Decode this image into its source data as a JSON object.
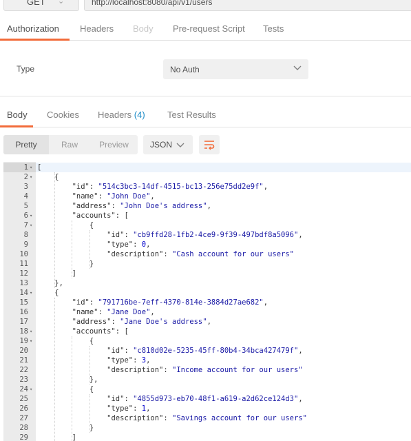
{
  "request": {
    "method": "GET",
    "url": "http://localhost:8080/api/v1/users"
  },
  "request_tabs": [
    "Authorization",
    "Headers",
    "Body",
    "Pre-request Script",
    "Tests"
  ],
  "auth": {
    "type_label": "Type",
    "selected": "No Auth"
  },
  "response_tabs": {
    "body": "Body",
    "cookies": "Cookies",
    "headers": "Headers",
    "headers_count": "(4)",
    "test_results": "Test Results"
  },
  "view_modes": [
    "Pretty",
    "Raw",
    "Preview"
  ],
  "format": "JSON",
  "colors": {
    "accent": "#f26b3a",
    "count": "#1a8ac7",
    "string": "#1a1aa6",
    "number": "#0000cd"
  },
  "code_lines": [
    {
      "n": "1",
      "fold": "▾",
      "t": "["
    },
    {
      "n": "2",
      "fold": "▾",
      "t": "    {"
    },
    {
      "n": "3",
      "fold": "",
      "t": "        \"id\": \"514c3bc3-14df-4515-bc13-256e75dd2e9f\","
    },
    {
      "n": "4",
      "fold": "",
      "t": "        \"name\": \"John Doe\","
    },
    {
      "n": "5",
      "fold": "",
      "t": "        \"address\": \"John Doe's address\","
    },
    {
      "n": "6",
      "fold": "▾",
      "t": "        \"accounts\": ["
    },
    {
      "n": "7",
      "fold": "▾",
      "t": "            {"
    },
    {
      "n": "8",
      "fold": "",
      "t": "                \"id\": \"cb9ffd28-1fb2-4ce9-9f39-497bdf8a5096\","
    },
    {
      "n": "9",
      "fold": "",
      "t": "                \"type\": 0,"
    },
    {
      "n": "10",
      "fold": "",
      "t": "                \"description\": \"Cash account for our users\""
    },
    {
      "n": "11",
      "fold": "",
      "t": "            }"
    },
    {
      "n": "12",
      "fold": "",
      "t": "        ]"
    },
    {
      "n": "13",
      "fold": "",
      "t": "    },"
    },
    {
      "n": "14",
      "fold": "▾",
      "t": "    {"
    },
    {
      "n": "15",
      "fold": "",
      "t": "        \"id\": \"791716be-7eff-4370-814e-3884d27ae682\","
    },
    {
      "n": "16",
      "fold": "",
      "t": "        \"name\": \"Jane Doe\","
    },
    {
      "n": "17",
      "fold": "",
      "t": "        \"address\": \"Jane Doe's address\","
    },
    {
      "n": "18",
      "fold": "▾",
      "t": "        \"accounts\": ["
    },
    {
      "n": "19",
      "fold": "▾",
      "t": "            {"
    },
    {
      "n": "20",
      "fold": "",
      "t": "                \"id\": \"c810d02e-5235-45ff-80b4-34bca427479f\","
    },
    {
      "n": "21",
      "fold": "",
      "t": "                \"type\": 3,"
    },
    {
      "n": "22",
      "fold": "",
      "t": "                \"description\": \"Income account for our users\""
    },
    {
      "n": "23",
      "fold": "",
      "t": "            },"
    },
    {
      "n": "24",
      "fold": "▾",
      "t": "            {"
    },
    {
      "n": "25",
      "fold": "",
      "t": "                \"id\": \"4855d973-eb70-48f1-a619-a2d62ce124d3\","
    },
    {
      "n": "26",
      "fold": "",
      "t": "                \"type\": 1,"
    },
    {
      "n": "27",
      "fold": "",
      "t": "                \"description\": \"Savings account for our users\""
    },
    {
      "n": "28",
      "fold": "",
      "t": "            }"
    },
    {
      "n": "29",
      "fold": "",
      "t": "        ]"
    }
  ]
}
